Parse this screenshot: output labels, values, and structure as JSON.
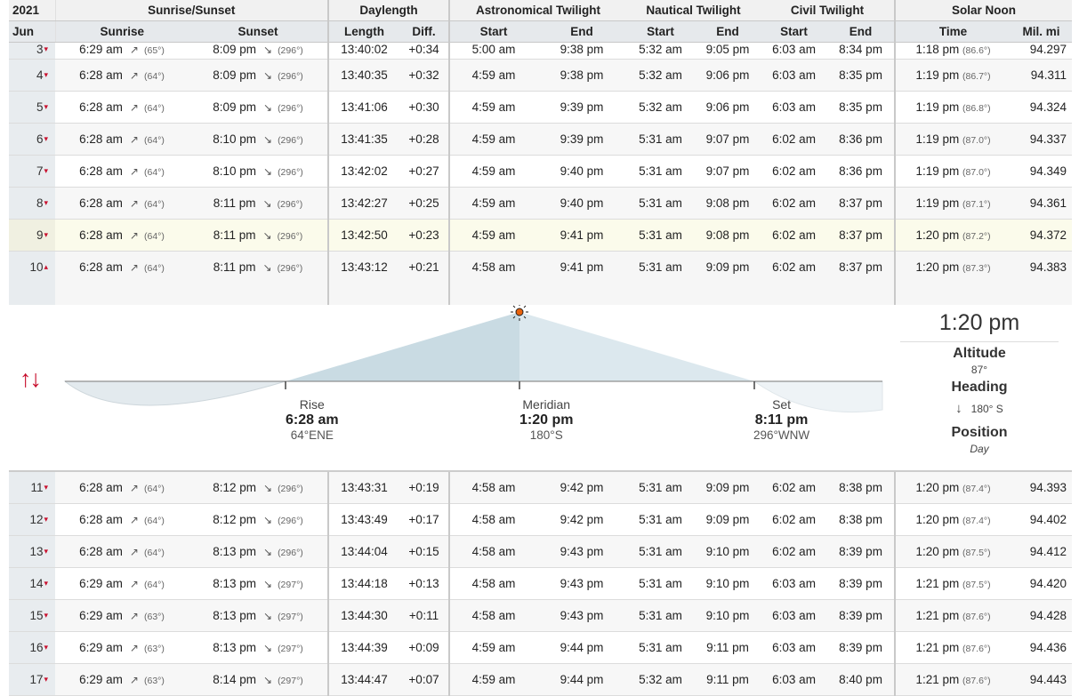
{
  "header": {
    "year": "2021",
    "month": "Jun",
    "groups": [
      "Sunrise/Sunset",
      "Daylength",
      "Astronomical Twilight",
      "Nautical Twilight",
      "Civil Twilight",
      "Solar Noon"
    ],
    "columns": [
      "Sunrise",
      "Sunset",
      "Length",
      "Diff.",
      "Start",
      "End",
      "Start",
      "End",
      "Start",
      "End",
      "Time",
      "Mil. mi"
    ]
  },
  "rows": [
    {
      "day": "3",
      "sunrise": "6:29 am",
      "rise_deg": "(65°)",
      "sunset": "8:09 pm",
      "set_deg": "(296°)",
      "length": "13:40:02",
      "diff": "+0:34",
      "astro_start": "5:00 am",
      "astro_end": "9:38 pm",
      "naut_start": "5:32 am",
      "naut_end": "9:05 pm",
      "civil_start": "6:03 am",
      "civil_end": "8:34 pm",
      "noon": "1:18 pm",
      "noon_deg": "(86.6°)",
      "dist": "94.297"
    },
    {
      "day": "4",
      "sunrise": "6:28 am",
      "rise_deg": "(64°)",
      "sunset": "8:09 pm",
      "set_deg": "(296°)",
      "length": "13:40:35",
      "diff": "+0:32",
      "astro_start": "4:59 am",
      "astro_end": "9:38 pm",
      "naut_start": "5:32 am",
      "naut_end": "9:06 pm",
      "civil_start": "6:03 am",
      "civil_end": "8:35 pm",
      "noon": "1:19 pm",
      "noon_deg": "(86.7°)",
      "dist": "94.311"
    },
    {
      "day": "5",
      "sunrise": "6:28 am",
      "rise_deg": "(64°)",
      "sunset": "8:09 pm",
      "set_deg": "(296°)",
      "length": "13:41:06",
      "diff": "+0:30",
      "astro_start": "4:59 am",
      "astro_end": "9:39 pm",
      "naut_start": "5:32 am",
      "naut_end": "9:06 pm",
      "civil_start": "6:03 am",
      "civil_end": "8:35 pm",
      "noon": "1:19 pm",
      "noon_deg": "(86.8°)",
      "dist": "94.324"
    },
    {
      "day": "6",
      "sunrise": "6:28 am",
      "rise_deg": "(64°)",
      "sunset": "8:10 pm",
      "set_deg": "(296°)",
      "length": "13:41:35",
      "diff": "+0:28",
      "astro_start": "4:59 am",
      "astro_end": "9:39 pm",
      "naut_start": "5:31 am",
      "naut_end": "9:07 pm",
      "civil_start": "6:02 am",
      "civil_end": "8:36 pm",
      "noon": "1:19 pm",
      "noon_deg": "(87.0°)",
      "dist": "94.337"
    },
    {
      "day": "7",
      "sunrise": "6:28 am",
      "rise_deg": "(64°)",
      "sunset": "8:10 pm",
      "set_deg": "(296°)",
      "length": "13:42:02",
      "diff": "+0:27",
      "astro_start": "4:59 am",
      "astro_end": "9:40 pm",
      "naut_start": "5:31 am",
      "naut_end": "9:07 pm",
      "civil_start": "6:02 am",
      "civil_end": "8:36 pm",
      "noon": "1:19 pm",
      "noon_deg": "(87.0°)",
      "dist": "94.349"
    },
    {
      "day": "8",
      "sunrise": "6:28 am",
      "rise_deg": "(64°)",
      "sunset": "8:11 pm",
      "set_deg": "(296°)",
      "length": "13:42:27",
      "diff": "+0:25",
      "astro_start": "4:59 am",
      "astro_end": "9:40 pm",
      "naut_start": "5:31 am",
      "naut_end": "9:08 pm",
      "civil_start": "6:02 am",
      "civil_end": "8:37 pm",
      "noon": "1:19 pm",
      "noon_deg": "(87.1°)",
      "dist": "94.361"
    },
    {
      "day": "9",
      "sunrise": "6:28 am",
      "rise_deg": "(64°)",
      "sunset": "8:11 pm",
      "set_deg": "(296°)",
      "length": "13:42:50",
      "diff": "+0:23",
      "astro_start": "4:59 am",
      "astro_end": "9:41 pm",
      "naut_start": "5:31 am",
      "naut_end": "9:08 pm",
      "civil_start": "6:02 am",
      "civil_end": "8:37 pm",
      "noon": "1:20 pm",
      "noon_deg": "(87.2°)",
      "dist": "94.372"
    }
  ],
  "expanded_row": {
    "day": "10",
    "sunrise": "6:28 am",
    "rise_deg": "(64°)",
    "sunset": "8:11 pm",
    "set_deg": "(296°)",
    "length": "13:43:12",
    "diff": "+0:21",
    "astro_start": "4:58 am",
    "astro_end": "9:41 pm",
    "naut_start": "5:31 am",
    "naut_end": "9:09 pm",
    "civil_start": "6:02 am",
    "civil_end": "8:37 pm",
    "noon": "1:20 pm",
    "noon_deg": "(87.3°)",
    "dist": "94.383"
  },
  "detail": {
    "sun_time": "1:20 pm",
    "altitude_label": "Altitude",
    "altitude": "87°",
    "heading_label": "Heading",
    "heading_arrow": "↓",
    "heading": "180° S",
    "position_label": "Position",
    "position": "Day",
    "updown_icon": "↑↓",
    "rise": {
      "label": "Rise",
      "time": "6:28 am",
      "dir": "64°ENE"
    },
    "meridian": {
      "label": "Meridian",
      "time": "1:20 pm",
      "dir": "180°S"
    },
    "set": {
      "label": "Set",
      "time": "8:11 pm",
      "dir": "296°WNW"
    }
  },
  "rows_after": [
    {
      "day": "11",
      "sunrise": "6:28 am",
      "rise_deg": "(64°)",
      "sunset": "8:12 pm",
      "set_deg": "(296°)",
      "length": "13:43:31",
      "diff": "+0:19",
      "astro_start": "4:58 am",
      "astro_end": "9:42 pm",
      "naut_start": "5:31 am",
      "naut_end": "9:09 pm",
      "civil_start": "6:02 am",
      "civil_end": "8:38 pm",
      "noon": "1:20 pm",
      "noon_deg": "(87.4°)",
      "dist": "94.393"
    },
    {
      "day": "12",
      "sunrise": "6:28 am",
      "rise_deg": "(64°)",
      "sunset": "8:12 pm",
      "set_deg": "(296°)",
      "length": "13:43:49",
      "diff": "+0:17",
      "astro_start": "4:58 am",
      "astro_end": "9:42 pm",
      "naut_start": "5:31 am",
      "naut_end": "9:09 pm",
      "civil_start": "6:02 am",
      "civil_end": "8:38 pm",
      "noon": "1:20 pm",
      "noon_deg": "(87.4°)",
      "dist": "94.402"
    },
    {
      "day": "13",
      "sunrise": "6:28 am",
      "rise_deg": "(64°)",
      "sunset": "8:13 pm",
      "set_deg": "(296°)",
      "length": "13:44:04",
      "diff": "+0:15",
      "astro_start": "4:58 am",
      "astro_end": "9:43 pm",
      "naut_start": "5:31 am",
      "naut_end": "9:10 pm",
      "civil_start": "6:02 am",
      "civil_end": "8:39 pm",
      "noon": "1:20 pm",
      "noon_deg": "(87.5°)",
      "dist": "94.412"
    },
    {
      "day": "14",
      "sunrise": "6:29 am",
      "rise_deg": "(64°)",
      "sunset": "8:13 pm",
      "set_deg": "(297°)",
      "length": "13:44:18",
      "diff": "+0:13",
      "astro_start": "4:58 am",
      "astro_end": "9:43 pm",
      "naut_start": "5:31 am",
      "naut_end": "9:10 pm",
      "civil_start": "6:03 am",
      "civil_end": "8:39 pm",
      "noon": "1:21 pm",
      "noon_deg": "(87.5°)",
      "dist": "94.420"
    },
    {
      "day": "15",
      "sunrise": "6:29 am",
      "rise_deg": "(63°)",
      "sunset": "8:13 pm",
      "set_deg": "(297°)",
      "length": "13:44:30",
      "diff": "+0:11",
      "astro_start": "4:58 am",
      "astro_end": "9:43 pm",
      "naut_start": "5:31 am",
      "naut_end": "9:10 pm",
      "civil_start": "6:03 am",
      "civil_end": "8:39 pm",
      "noon": "1:21 pm",
      "noon_deg": "(87.6°)",
      "dist": "94.428"
    },
    {
      "day": "16",
      "sunrise": "6:29 am",
      "rise_deg": "(63°)",
      "sunset": "8:13 pm",
      "set_deg": "(297°)",
      "length": "13:44:39",
      "diff": "+0:09",
      "astro_start": "4:59 am",
      "astro_end": "9:44 pm",
      "naut_start": "5:31 am",
      "naut_end": "9:11 pm",
      "civil_start": "6:03 am",
      "civil_end": "8:39 pm",
      "noon": "1:21 pm",
      "noon_deg": "(87.6°)",
      "dist": "94.436"
    },
    {
      "day": "17",
      "sunrise": "6:29 am",
      "rise_deg": "(63°)",
      "sunset": "8:14 pm",
      "set_deg": "(297°)",
      "length": "13:44:47",
      "diff": "+0:07",
      "astro_start": "4:59 am",
      "astro_end": "9:44 pm",
      "naut_start": "5:32 am",
      "naut_end": "9:11 pm",
      "civil_start": "6:03 am",
      "civil_end": "8:40 pm",
      "noon": "1:21 pm",
      "noon_deg": "(87.6°)",
      "dist": "94.443"
    }
  ],
  "icons": {
    "sunrise": "sunrise-arrow-icon",
    "sunset": "sunset-arrow-icon",
    "chevron_down": "chevron-down-icon",
    "chevron_up": "chevron-up-icon",
    "sun": "sun-icon",
    "updown": "up-down-arrows-icon"
  },
  "colors": {
    "accent": "#c8102e",
    "today": "#fbfbeb",
    "sky": "#c9dbe3"
  }
}
